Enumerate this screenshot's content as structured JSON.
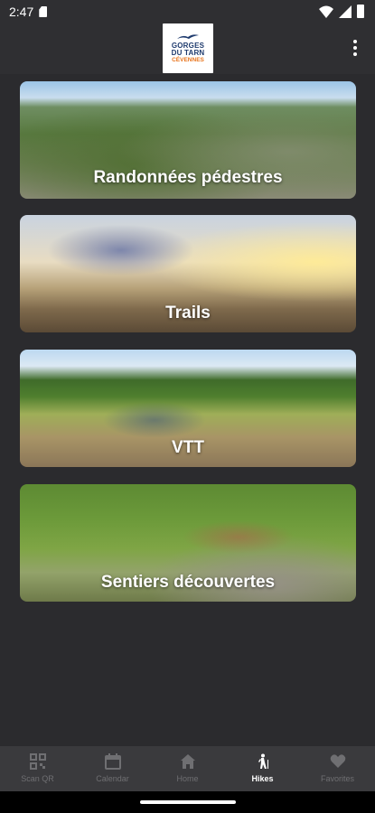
{
  "status_bar": {
    "time": "2:47",
    "icons": [
      "sim-card-icon",
      "wifi-icon",
      "signal-icon",
      "battery-icon"
    ]
  },
  "app_bar": {
    "logo": {
      "line1": "GORGES",
      "line2": "DU TARN",
      "line3": "CÉVENNES"
    },
    "menu_icon": "more-vert-icon"
  },
  "categories": [
    {
      "title": "Randonnées pédestres"
    },
    {
      "title": "Trails"
    },
    {
      "title": "VTT"
    },
    {
      "title": "Sentiers découvertes"
    }
  ],
  "bottom_nav": {
    "items": [
      {
        "label": "Scan QR",
        "icon": "qr-code-icon",
        "active": false
      },
      {
        "label": "Calendar",
        "icon": "calendar-icon",
        "active": false
      },
      {
        "label": "Home",
        "icon": "home-icon",
        "active": false
      },
      {
        "label": "Hikes",
        "icon": "hiker-icon",
        "active": true
      },
      {
        "label": "Favorites",
        "icon": "heart-icon",
        "active": false
      }
    ]
  },
  "colors": {
    "background": "#2b2b2e",
    "appbar": "#2f2f32",
    "bottom_nav": "#3a3a3d",
    "nav_inactive": "#6f6f72",
    "nav_active": "#ffffff",
    "logo_blue": "#1f3b6e",
    "logo_orange": "#e8741c"
  }
}
